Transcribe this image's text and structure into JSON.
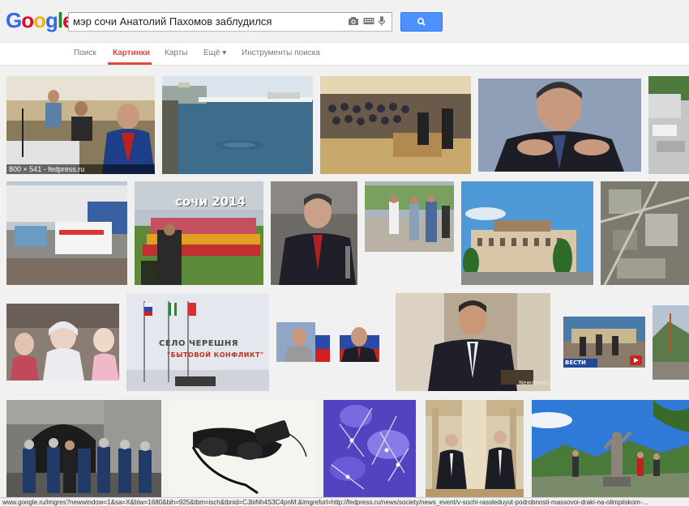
{
  "header": {
    "logo_text": "Google",
    "search_query": "мэр сочи Анатолий Пахомов заблудился",
    "icons": [
      "camera-icon",
      "keyboard-icon",
      "microphone-icon",
      "search-icon"
    ]
  },
  "nav": {
    "items": [
      {
        "label": "Поиск",
        "active": false
      },
      {
        "label": "Картинки",
        "active": true
      },
      {
        "label": "Карты",
        "active": false
      },
      {
        "label": "Ещё ▾",
        "active": false
      },
      {
        "label": "Инструменты поиска",
        "active": false
      }
    ]
  },
  "results": {
    "first_caption": "800 × 541 - fedpress.ru",
    "overlay_texts": {
      "sochi_2014": "сочи 2014",
      "village_line1": "СЕЛО ЧЕРЕШНЯ",
      "village_line2": "\"БЫТОВОЙ КОНФЛИКТ\"",
      "watermark": "Newsochi.ru",
      "vesti": "ВЕСТИ"
    }
  },
  "status_bar": {
    "url": "www.google.ru/imgres?newwindow=1&sa=X&biw=1680&bih=925&tbm=isch&tbnid=CJbiNh4S3C4pnM:&imgrefurl=http://fedpress.ru/news/society/news_event/v-sochi-rassleduyut-podrobnosti-massovoi-draki-na-olimpiiskom-..."
  },
  "colors": {
    "nav_active": "#dd4b39",
    "search_button": "#4d90fe",
    "logo_blue": "#3369e8",
    "logo_red": "#d50f25",
    "logo_yellow": "#eeb211",
    "logo_green": "#009925"
  }
}
